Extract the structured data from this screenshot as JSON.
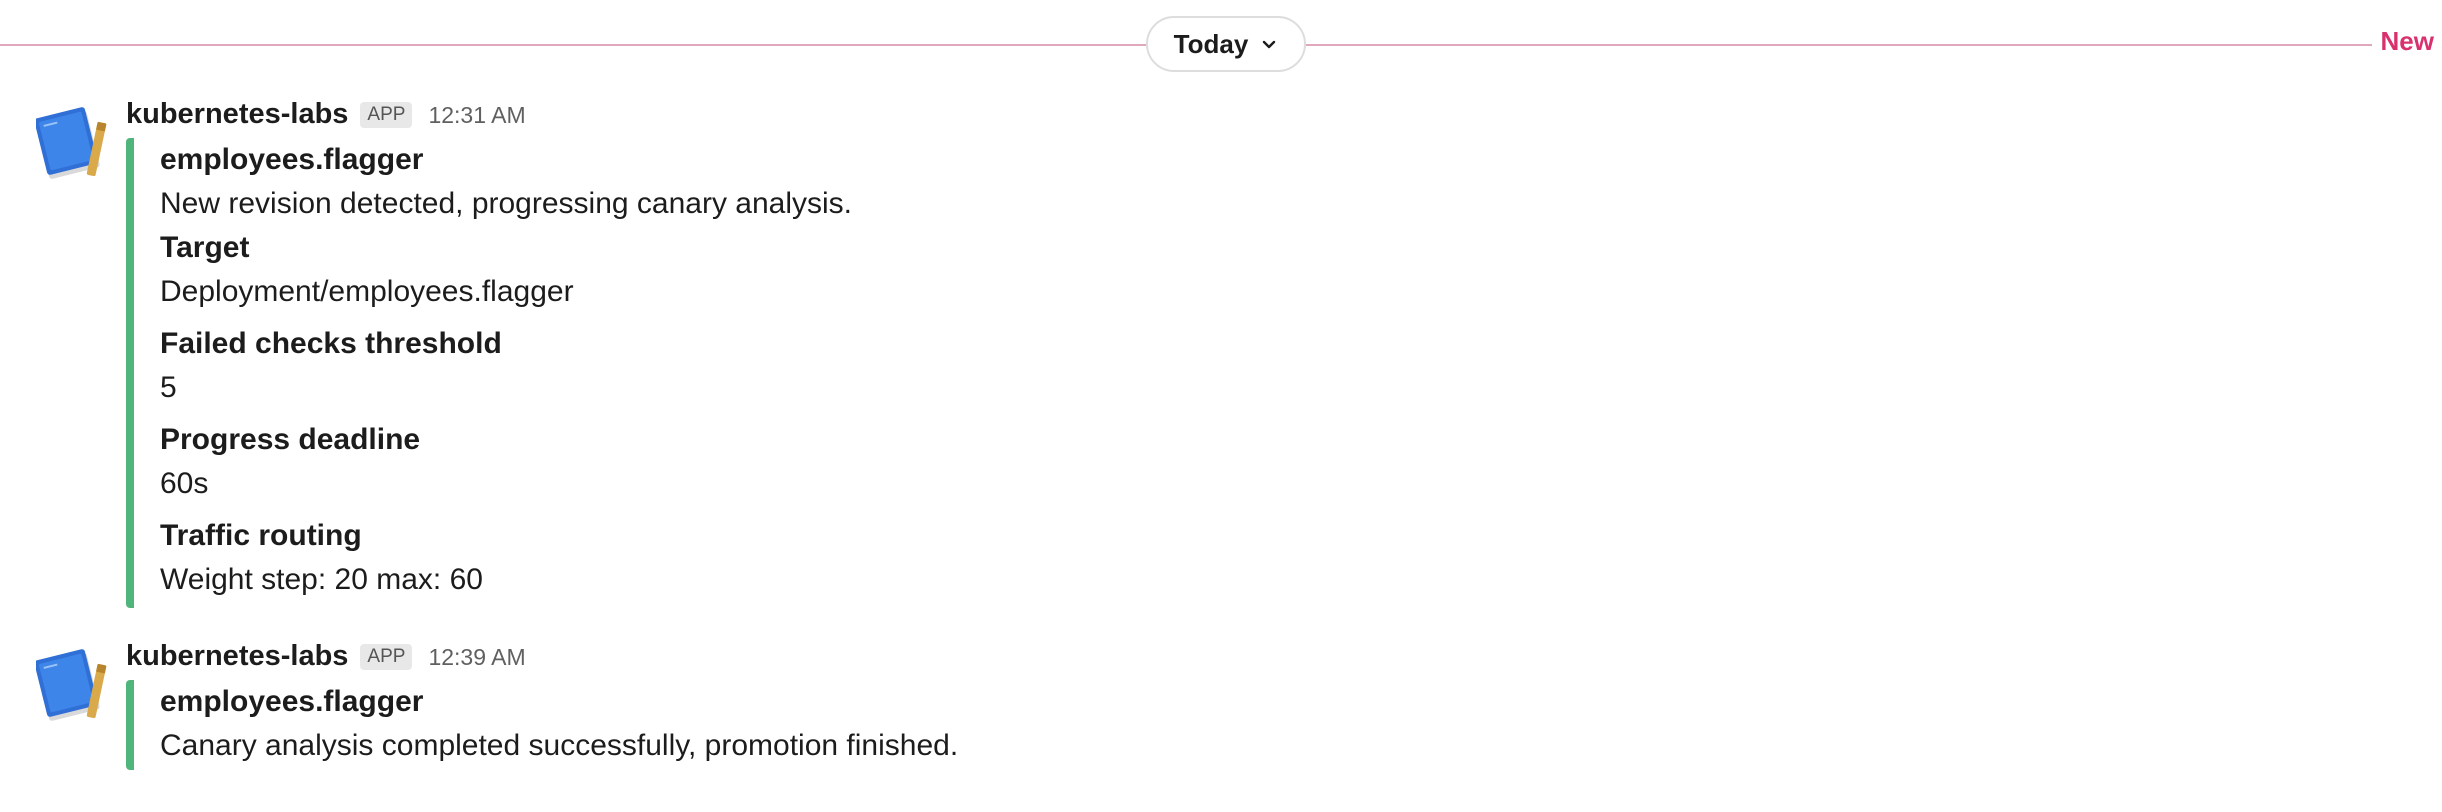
{
  "divider": {
    "date_label": "Today",
    "new_label": "New",
    "chevron_icon": "chevron-down-icon",
    "line_color": "#e0a8bd",
    "new_color": "#d8316d"
  },
  "messages": [
    {
      "sender": "kubernetes-labs",
      "badge": "APP",
      "time": "12:31 AM",
      "avatar_icon": "blue-book-avatar-icon",
      "attachment": {
        "color": "#4fb57a",
        "title": "employees.flagger",
        "text": "New revision detected, progressing canary analysis.",
        "fields": [
          {
            "title": "Target",
            "value": "Deployment/employees.flagger"
          },
          {
            "title": "Failed checks threshold",
            "value": "5"
          },
          {
            "title": "Progress deadline",
            "value": "60s"
          },
          {
            "title": "Traffic routing",
            "value": "Weight step: 20 max: 60"
          }
        ]
      }
    },
    {
      "sender": "kubernetes-labs",
      "badge": "APP",
      "time": "12:39 AM",
      "avatar_icon": "blue-book-avatar-icon",
      "attachment": {
        "color": "#4fb57a",
        "title": "employees.flagger",
        "text": "Canary analysis completed successfully, promotion finished."
      }
    }
  ]
}
